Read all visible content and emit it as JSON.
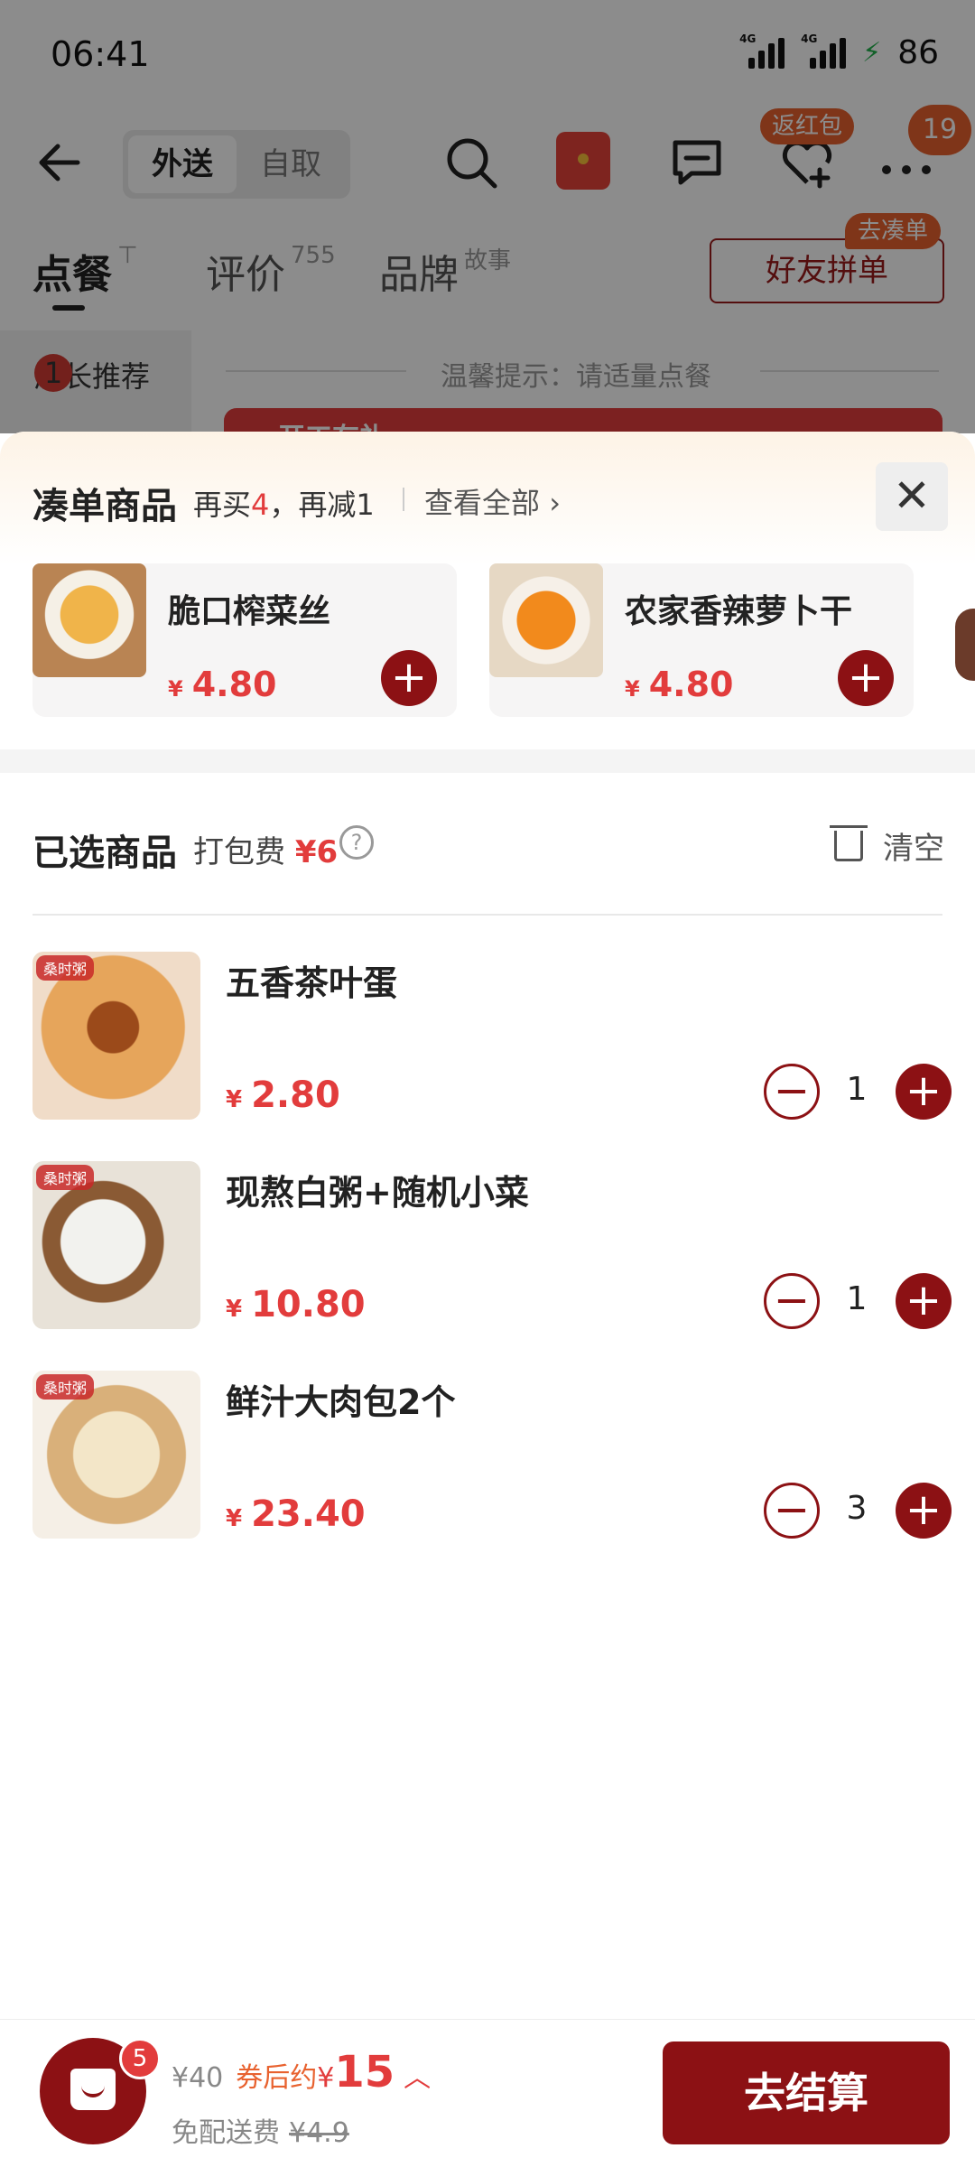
{
  "status_bar": {
    "time": "06:41",
    "signal_1": "4G",
    "signal_2": "4G",
    "battery": "86"
  },
  "nav": {
    "delivery_mode_options": [
      "外送",
      "自取"
    ],
    "selected_mode": "外送",
    "fav_badge": "返红包",
    "more_badge": "19"
  },
  "tabs": {
    "order": "点餐",
    "review": "评价",
    "review_count": "755",
    "brand": "品牌",
    "brand_sub": "故事",
    "friend_button": "好友拼单",
    "friend_tag": "去凑单"
  },
  "background": {
    "category": "店长推荐",
    "category_badge": "1",
    "tip": "温馨提示：请适量点餐",
    "promo": "开工有礼"
  },
  "addon": {
    "title": "凑单商品",
    "sub_prefix": "再买",
    "sub_count": "4",
    "sub_suffix": "，再减1",
    "view_all": "查看全部",
    "items": [
      {
        "name": "脆口榨菜丝",
        "currency": "¥",
        "price": "4.80"
      },
      {
        "name": "农家香辣萝卜干",
        "currency": "¥",
        "price": "4.80"
      }
    ]
  },
  "selected": {
    "title": "已选商品",
    "fee_label": "打包费",
    "fee_value": "¥6",
    "clear": "清空",
    "brand_tag": "桑时粥",
    "items": [
      {
        "name": "五香茶叶蛋",
        "currency": "¥",
        "price": "2.80",
        "qty": "1"
      },
      {
        "name": "现熬白粥+随机小菜",
        "currency": "¥",
        "price": "10.80",
        "qty": "1"
      },
      {
        "name": "鲜汁大肉包2个",
        "currency": "¥",
        "price": "23.40",
        "qty": "3"
      }
    ]
  },
  "bottom": {
    "cart_count": "5",
    "original_total": "¥40",
    "after_label": "券后约",
    "currency": "¥",
    "after_total": "15",
    "delivery_label": "免配送费",
    "delivery_orig": "¥4.9",
    "checkout": "去结算"
  },
  "colors": {
    "brand": "#8c1114",
    "price": "#e23c3c",
    "accent": "#e8622f"
  }
}
